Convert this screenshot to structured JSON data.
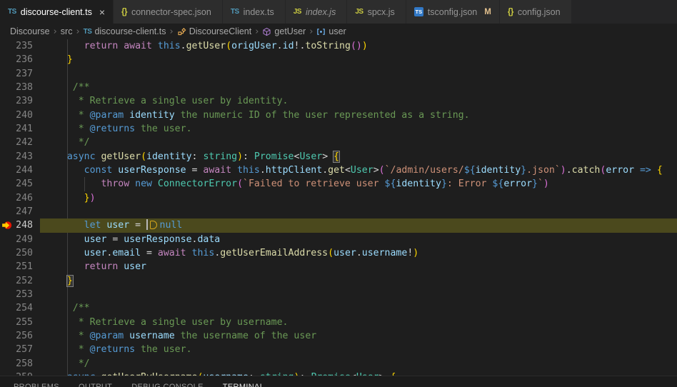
{
  "tabs": [
    {
      "label": "discourse-client.ts",
      "icon": "ts",
      "active": true,
      "close": "×"
    },
    {
      "label": "connector-spec.json",
      "icon": "json",
      "active": false
    },
    {
      "label": "index.ts",
      "icon": "ts",
      "active": false
    },
    {
      "label": "index.js",
      "icon": "js",
      "active": false,
      "preview": true
    },
    {
      "label": "spcx.js",
      "icon": "js",
      "active": false
    },
    {
      "label": "tsconfig.json",
      "icon": "tsconfig",
      "active": false,
      "badge": "M"
    },
    {
      "label": "config.json",
      "icon": "json",
      "active": false
    }
  ],
  "breadcrumb": [
    {
      "label": "Discourse"
    },
    {
      "label": "src"
    },
    {
      "label": "discourse-client.ts",
      "icon": "ts"
    },
    {
      "label": "DiscourseClient",
      "icon": "class"
    },
    {
      "label": "getUser",
      "icon": "method"
    },
    {
      "label": "user",
      "icon": "variable"
    }
  ],
  "editor": {
    "token_colors": {
      "kw": "#569cd6",
      "ctrl": "#c586c0",
      "fn": "#dcdcaa",
      "var": "#9cdcfe",
      "type": "#4ec9b0",
      "str": "#ce9178",
      "cmt": "#6a9955",
      "tag": "#569cd6",
      "pun": "#d4d4d4",
      "b1": "#ffd700",
      "b1m": "#ffd700",
      "b2": "#da70d6",
      "interp": "#569cd6"
    },
    "debug_colors": {
      "breakpoint": "#e51400",
      "arrow": "#ffcc00",
      "line_highlight": "#4b491d"
    },
    "lines": [
      {
        "num": "235",
        "tokens": [
          [
            "pun",
            "      "
          ],
          [
            "ctrl",
            "return"
          ],
          [
            "pun",
            " "
          ],
          [
            "ctrl",
            "await"
          ],
          [
            "pun",
            " "
          ],
          [
            "kw",
            "this"
          ],
          [
            "pun",
            "."
          ],
          [
            "fn",
            "getUser"
          ],
          [
            "b1",
            "("
          ],
          [
            "var",
            "origUser"
          ],
          [
            "pun",
            "."
          ],
          [
            "var",
            "id"
          ],
          [
            "pun",
            "!."
          ],
          [
            "fn",
            "toString"
          ],
          [
            "b2",
            "()"
          ],
          [
            "b1",
            ")"
          ]
        ]
      },
      {
        "num": "236",
        "tokens": [
          [
            "pun",
            "   "
          ],
          [
            "b1",
            "}"
          ]
        ]
      },
      {
        "num": "237",
        "tokens": []
      },
      {
        "num": "238",
        "tokens": [
          [
            "cmt",
            "    /**"
          ]
        ]
      },
      {
        "num": "239",
        "tokens": [
          [
            "cmt",
            "     * Retrieve a single user by identity."
          ]
        ]
      },
      {
        "num": "240",
        "tokens": [
          [
            "cmt",
            "     * "
          ],
          [
            "tag",
            "@param"
          ],
          [
            "cmt",
            " "
          ],
          [
            "var",
            "identity"
          ],
          [
            "cmt",
            " the numeric ID of the user represented as a string."
          ]
        ]
      },
      {
        "num": "241",
        "tokens": [
          [
            "cmt",
            "     * "
          ],
          [
            "tag",
            "@returns"
          ],
          [
            "cmt",
            " the user."
          ]
        ]
      },
      {
        "num": "242",
        "tokens": [
          [
            "cmt",
            "     */"
          ]
        ]
      },
      {
        "num": "243",
        "tokens": [
          [
            "pun",
            "   "
          ],
          [
            "kw",
            "async"
          ],
          [
            "pun",
            " "
          ],
          [
            "fn",
            "getUser"
          ],
          [
            "b1",
            "("
          ],
          [
            "var",
            "identity"
          ],
          [
            "pun",
            ": "
          ],
          [
            "type",
            "string"
          ],
          [
            "b1",
            ")"
          ],
          [
            "pun",
            ": "
          ],
          [
            "type",
            "Promise"
          ],
          [
            "pun",
            "<"
          ],
          [
            "type",
            "User"
          ],
          [
            "pun",
            "> "
          ],
          [
            "b1m",
            "{"
          ]
        ]
      },
      {
        "num": "244",
        "tokens": [
          [
            "pun",
            "      "
          ],
          [
            "kw",
            "const"
          ],
          [
            "pun",
            " "
          ],
          [
            "var",
            "userResponse"
          ],
          [
            "pun",
            " = "
          ],
          [
            "ctrl",
            "await"
          ],
          [
            "pun",
            " "
          ],
          [
            "kw",
            "this"
          ],
          [
            "pun",
            "."
          ],
          [
            "var",
            "httpClient"
          ],
          [
            "pun",
            "."
          ],
          [
            "fn",
            "get"
          ],
          [
            "pun",
            "<"
          ],
          [
            "type",
            "User"
          ],
          [
            "pun",
            ">"
          ],
          [
            "b2",
            "("
          ],
          [
            "str",
            "`/admin/users/"
          ],
          [
            "interp",
            "${"
          ],
          [
            "var",
            "identity"
          ],
          [
            "interp",
            "}"
          ],
          [
            "str",
            ".json`"
          ],
          [
            "b2",
            ")"
          ],
          [
            "pun",
            "."
          ],
          [
            "fn",
            "catch"
          ],
          [
            "b2",
            "("
          ],
          [
            "var",
            "error"
          ],
          [
            "pun",
            " "
          ],
          [
            "kw",
            "=>"
          ],
          [
            "pun",
            " "
          ],
          [
            "b1",
            "{"
          ]
        ]
      },
      {
        "num": "245",
        "tokens": [
          [
            "pun",
            "         "
          ],
          [
            "ctrl",
            "throw"
          ],
          [
            "pun",
            " "
          ],
          [
            "kw",
            "new"
          ],
          [
            "pun",
            " "
          ],
          [
            "type",
            "ConnectorError"
          ],
          [
            "b2",
            "("
          ],
          [
            "str",
            "`Failed to retrieve user "
          ],
          [
            "interp",
            "${"
          ],
          [
            "var",
            "identity"
          ],
          [
            "interp",
            "}"
          ],
          [
            "str",
            ": Error "
          ],
          [
            "interp",
            "${"
          ],
          [
            "var",
            "error"
          ],
          [
            "interp",
            "}"
          ],
          [
            "str",
            "`"
          ],
          [
            "b2",
            ")"
          ]
        ]
      },
      {
        "num": "246",
        "tokens": [
          [
            "pun",
            "      "
          ],
          [
            "b1",
            "}"
          ],
          [
            "b2",
            ")"
          ]
        ]
      },
      {
        "num": "247",
        "tokens": []
      },
      {
        "num": "248",
        "current": true,
        "gutter": "breakpoint-arrow",
        "tokens": [
          [
            "pun",
            "      "
          ],
          [
            "kw",
            "let"
          ],
          [
            "pun",
            " "
          ],
          [
            "var",
            "user"
          ],
          [
            "pun",
            " = "
          ],
          [
            "cursor",
            ""
          ],
          [
            "dicon",
            ""
          ],
          [
            "kw",
            "null"
          ]
        ]
      },
      {
        "num": "249",
        "tokens": [
          [
            "pun",
            "      "
          ],
          [
            "var",
            "user"
          ],
          [
            "pun",
            " = "
          ],
          [
            "var",
            "userResponse"
          ],
          [
            "pun",
            "."
          ],
          [
            "var",
            "data"
          ]
        ]
      },
      {
        "num": "250",
        "tokens": [
          [
            "pun",
            "      "
          ],
          [
            "var",
            "user"
          ],
          [
            "pun",
            "."
          ],
          [
            "var",
            "email"
          ],
          [
            "pun",
            " = "
          ],
          [
            "ctrl",
            "await"
          ],
          [
            "pun",
            " "
          ],
          [
            "kw",
            "this"
          ],
          [
            "pun",
            "."
          ],
          [
            "fn",
            "getUserEmailAddress"
          ],
          [
            "b1",
            "("
          ],
          [
            "var",
            "user"
          ],
          [
            "pun",
            "."
          ],
          [
            "var",
            "username"
          ],
          [
            "pun",
            "!"
          ],
          [
            "b1",
            ")"
          ]
        ]
      },
      {
        "num": "251",
        "tokens": [
          [
            "pun",
            "      "
          ],
          [
            "ctrl",
            "return"
          ],
          [
            "pun",
            " "
          ],
          [
            "var",
            "user"
          ]
        ]
      },
      {
        "num": "252",
        "tokens": [
          [
            "pun",
            "   "
          ],
          [
            "b1m",
            "}"
          ]
        ]
      },
      {
        "num": "253",
        "tokens": []
      },
      {
        "num": "254",
        "tokens": [
          [
            "cmt",
            "    /**"
          ]
        ]
      },
      {
        "num": "255",
        "tokens": [
          [
            "cmt",
            "     * Retrieve a single user by username."
          ]
        ]
      },
      {
        "num": "256",
        "tokens": [
          [
            "cmt",
            "     * "
          ],
          [
            "tag",
            "@param"
          ],
          [
            "cmt",
            " "
          ],
          [
            "var",
            "username"
          ],
          [
            "cmt",
            " the username of the user"
          ]
        ]
      },
      {
        "num": "257",
        "tokens": [
          [
            "cmt",
            "     * "
          ],
          [
            "tag",
            "@returns"
          ],
          [
            "cmt",
            " the user."
          ]
        ]
      },
      {
        "num": "258",
        "tokens": [
          [
            "cmt",
            "     */"
          ]
        ]
      },
      {
        "num": "259",
        "tokens": [
          [
            "pun",
            "   "
          ],
          [
            "kw",
            "async"
          ],
          [
            "pun",
            " "
          ],
          [
            "fn",
            "getUserByUsername"
          ],
          [
            "b1",
            "("
          ],
          [
            "var",
            "username"
          ],
          [
            "pun",
            ": "
          ],
          [
            "type",
            "string"
          ],
          [
            "b1",
            ")"
          ],
          [
            "pun",
            ": "
          ],
          [
            "type",
            "Promise"
          ],
          [
            "pun",
            "<"
          ],
          [
            "type",
            "User"
          ],
          [
            "pun",
            "> "
          ],
          [
            "b1",
            "{"
          ]
        ]
      }
    ]
  },
  "panel": {
    "tabs": [
      {
        "label": "PROBLEMS"
      },
      {
        "label": "OUTPUT"
      },
      {
        "label": "DEBUG CONSOLE"
      },
      {
        "label": "TERMINAL",
        "active": true
      }
    ]
  }
}
